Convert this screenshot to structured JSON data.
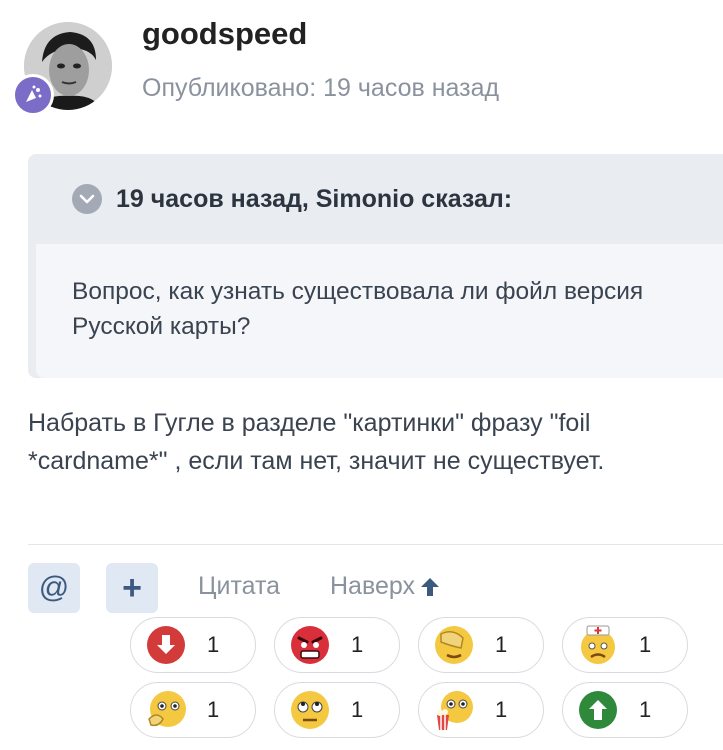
{
  "post": {
    "username": "goodspeed",
    "published": "Опубликовано: 19 часов назад",
    "quote_header": "19 часов назад, Simonio сказал:",
    "quote_line1": "Вопрос, как узнать существовала ли фойл версия",
    "quote_line2": "Русской карты?",
    "text_line1": "Набрать в Гугле в разделе \"картинки\" фразу \"foil",
    "text_line2": "*cardname*\" , если там нет, значит не существует."
  },
  "toolbar": {
    "mention_label": "@",
    "add_label": "+",
    "quote_label": "Цитата",
    "top_label": "Наверх"
  },
  "reactions": [
    {
      "name": "downvote-icon",
      "count": "1"
    },
    {
      "name": "angry-face-icon",
      "count": "1"
    },
    {
      "name": "facepalm-icon",
      "count": "1"
    },
    {
      "name": "sick-face-icon",
      "count": "1"
    },
    {
      "name": "thinking-face-icon",
      "count": "1"
    },
    {
      "name": "rolling-eyes-icon",
      "count": "1"
    },
    {
      "name": "popcorn-face-icon",
      "count": "1"
    },
    {
      "name": "upvote-icon",
      "count": "1"
    }
  ],
  "colors": {
    "accent": "#3c5a80",
    "muted": "#8a929e",
    "quote_bg": "#e9ecf1"
  }
}
